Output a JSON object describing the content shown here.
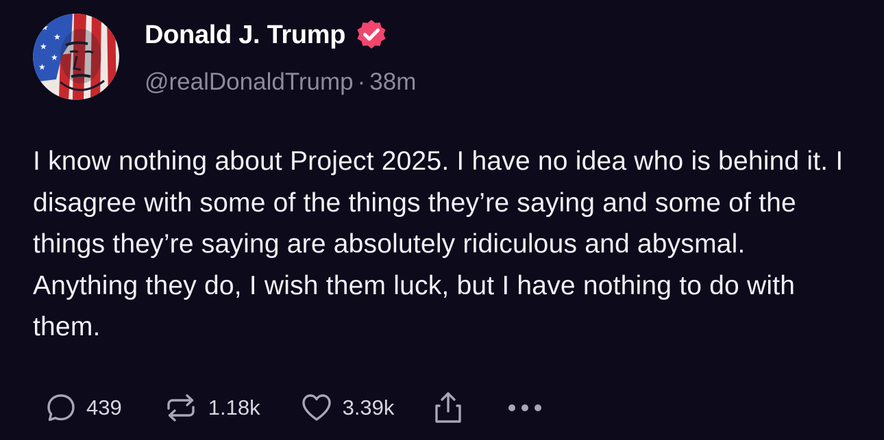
{
  "author": {
    "display_name": "Donald J. Trump",
    "handle": "@realDonaldTrump",
    "separator": "·",
    "time_ago": "38m",
    "verified": true,
    "verified_color": "#f0466e"
  },
  "post": {
    "text": "I know nothing about Project 2025. I have no idea who is behind it. I disagree with some of the things they’re saying and some of the things they’re saying are absolutely ridiculous and abysmal. Anything they do, I wish them luck, but I have nothing to do with them."
  },
  "actions": {
    "replies": "439",
    "reposts": "1.18k",
    "likes": "3.39k",
    "reply_icon": "speech-bubble-icon",
    "repost_icon": "repost-arrows-icon",
    "like_icon": "heart-outline-icon",
    "share_icon": "share-upload-icon",
    "more_icon": "more-dots-icon"
  },
  "colors": {
    "background": "#0c0a1b",
    "text": "#f2f1f7",
    "muted": "#8c8a9c",
    "icon": "#a9a7b6"
  }
}
